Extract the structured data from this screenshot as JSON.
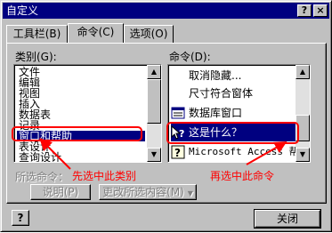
{
  "window": {
    "title": "自定义"
  },
  "titlebar": {
    "help_glyph": "?",
    "close_glyph": "×"
  },
  "tabs": [
    {
      "label": "工具栏(B)"
    },
    {
      "label": "命令(C)"
    },
    {
      "label": "选项(O)"
    }
  ],
  "categories": {
    "label": "类别(G):",
    "items": [
      "文件",
      "编辑",
      "视图",
      "插入",
      "数据表",
      "记录",
      "窗口和帮助",
      "表设计",
      "查询设计"
    ],
    "selected": "窗口和帮助"
  },
  "commands": {
    "label": "命令(D):",
    "items": [
      {
        "label": "取消隐藏...",
        "icon": "none"
      },
      {
        "label": "尺寸符合窗体",
        "icon": "none"
      },
      {
        "label": "数据库窗口",
        "icon": "database-window-icon"
      },
      {
        "label": "这是什么？",
        "icon": "whats-this-icon"
      },
      {
        "label": "Microsoft Access 帮助",
        "icon": "help-icon"
      }
    ],
    "selected": "这是什么？"
  },
  "selected_command": {
    "label": "所选命令：",
    "description_button": "说明(P)",
    "modify_button": "更改所选内容(M)"
  },
  "footer": {
    "help_button": "?",
    "close_button": "关闭"
  },
  "annotations": {
    "left": "先选中此类别",
    "right": "再选中此命令",
    "color": "#ff0000"
  },
  "colors": {
    "selection": "#000080",
    "face": "#c0c0c0"
  }
}
